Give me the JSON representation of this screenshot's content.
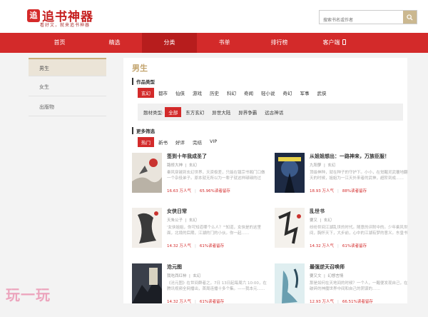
{
  "brand": {
    "logo_mark": "追",
    "name": "追书神器",
    "slogan": "看好文，就来追书神器"
  },
  "search": {
    "placeholder": "搜索书名或作者"
  },
  "nav": {
    "items": [
      "首页",
      "精选",
      "分类",
      "书单",
      "排行榜",
      "客户端"
    ],
    "active_index": 2
  },
  "sidebar": {
    "items": [
      "男生",
      "女生",
      "出版物"
    ],
    "active_index": 0
  },
  "main": {
    "title": "男生",
    "genre_title": "作品类型",
    "genres": [
      "玄幻",
      "都市",
      "仙侠",
      "游戏",
      "历史",
      "科幻",
      "奇闻",
      "轻小说",
      "奇幻",
      "军事",
      "武侠"
    ],
    "genre_active": 0,
    "subgenre_label": "题材类型:",
    "subgenres": [
      "全部",
      "东方玄幻",
      "异世大陆",
      "异界争霸",
      "远古神话"
    ],
    "subgenre_active": 0,
    "filter_title": "更多筛选",
    "filters": [
      "热门",
      "新书",
      "好评",
      "完结",
      "VIP"
    ],
    "filter_active": 0
  },
  "books": [
    {
      "title": "签到十年我成圣了",
      "author": "路修大神",
      "genre": "玄幻",
      "desc": "秦风穿越到玄幻世界，天资极差，只能在镇宗书阁门口做一个杂役弟子。原本就无所以为一辈子就这样碌碌的过去……",
      "popularity": "16.63 万人气",
      "retention": "65.96%读者留存"
    },
    {
      "title": "从姐姐想出：一路神来，万族臣服！",
      "author": "九阳萝",
      "genre": "玄幻",
      "desc": "顶级神种，就在种子的守护下。小小，在觉醒灵武覆地翻天的时候，姐姐为一江天外来者的武神，超阶到成……",
      "popularity": "18.93 万人气",
      "retention": "88%读者留存"
    },
    {
      "title": "女侠日常",
      "author": "天朱公子",
      "genre": "玄幻",
      "desc": "'女侠姐姐，你可知道哪个么人？'\"知道，女侠是的这里面，北境的后期，江湖的门的小伙。你一起……",
      "popularity": "14.32 万人气",
      "retention": "61%读者留存"
    },
    {
      "title": "乱世书",
      "author": "要又",
      "genre": "玄幻",
      "desc": "纷纷世间江湖乱世的时代。随意的评附中的。少年乘风世间，胸怀天下，大步前，心中的江湖有梦的意义。东皇书中…",
      "popularity": "14.32 万人气",
      "retention": "61%读者留存"
    },
    {
      "title": "沧元图",
      "author": "我吃西红柿",
      "genre": "玄幻",
      "desc": "《沧元图》在世间群者之，7日 13日起每周六 10:00，在腾讯视频全网播出，首周连播十多个集。——我本元……",
      "popularity": "14.32 万人气",
      "retention": "61%读者留存"
    },
    {
      "title": "最强逆天召唤师",
      "author": "要又文",
      "genre": "幻想言情",
      "desc": "那是如何在天地间的时候？一个人，一醒便发现自己，在破碎的神魔世界中间和自己的阴谋的……",
      "popularity": "12.93 万人气",
      "retention": "66.51%读者留存"
    }
  ],
  "watermark": "玩一玩",
  "colors": {
    "brand_red": "#d32a2a",
    "nav_active": "#b71d1d",
    "gold": "#c2a36c",
    "search_button": "#cbb890"
  }
}
